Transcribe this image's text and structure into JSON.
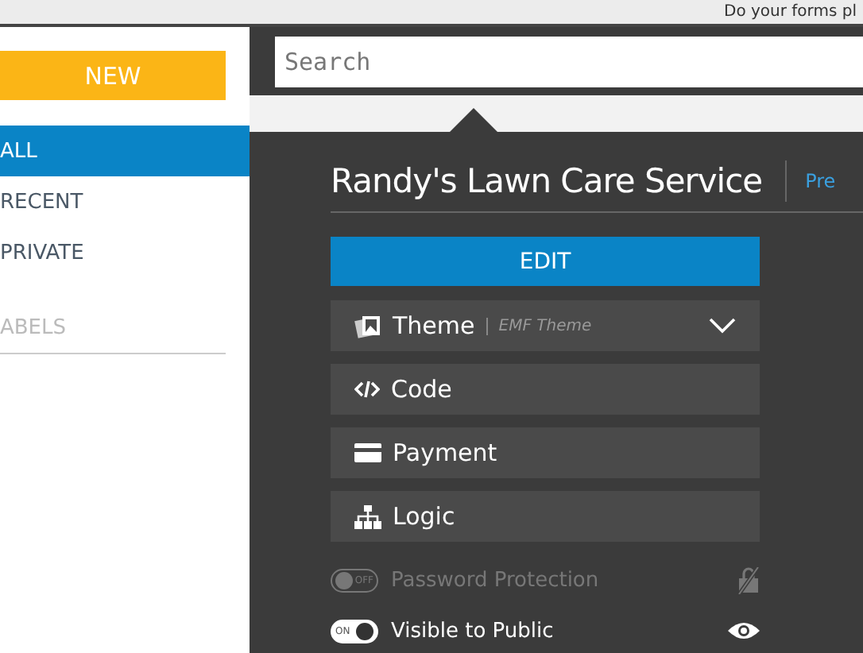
{
  "top_bar": {
    "text": "Do your forms pl"
  },
  "sidebar": {
    "new_button": "NEW",
    "items": [
      {
        "label": "ALL",
        "selected": true
      },
      {
        "label": "RECENT",
        "selected": false
      },
      {
        "label": "PRIVATE",
        "selected": false
      }
    ],
    "labels_heading": "ABELS"
  },
  "search": {
    "placeholder": "Search"
  },
  "panel": {
    "title": "Randy's Lawn Care Service",
    "link": "Pre",
    "edit_button": "EDIT",
    "options": [
      {
        "kind": "theme",
        "label": "Theme",
        "value": "EMF Theme"
      },
      {
        "kind": "code",
        "label": "Code"
      },
      {
        "kind": "payment",
        "label": "Payment"
      },
      {
        "kind": "logic",
        "label": "Logic"
      }
    ],
    "toggles": [
      {
        "kind": "password",
        "label": "Password Protection",
        "on": false,
        "switch_text": "OFF"
      },
      {
        "kind": "visibility",
        "label": "Visible to Public",
        "on": true,
        "switch_text": "ON"
      }
    ]
  }
}
